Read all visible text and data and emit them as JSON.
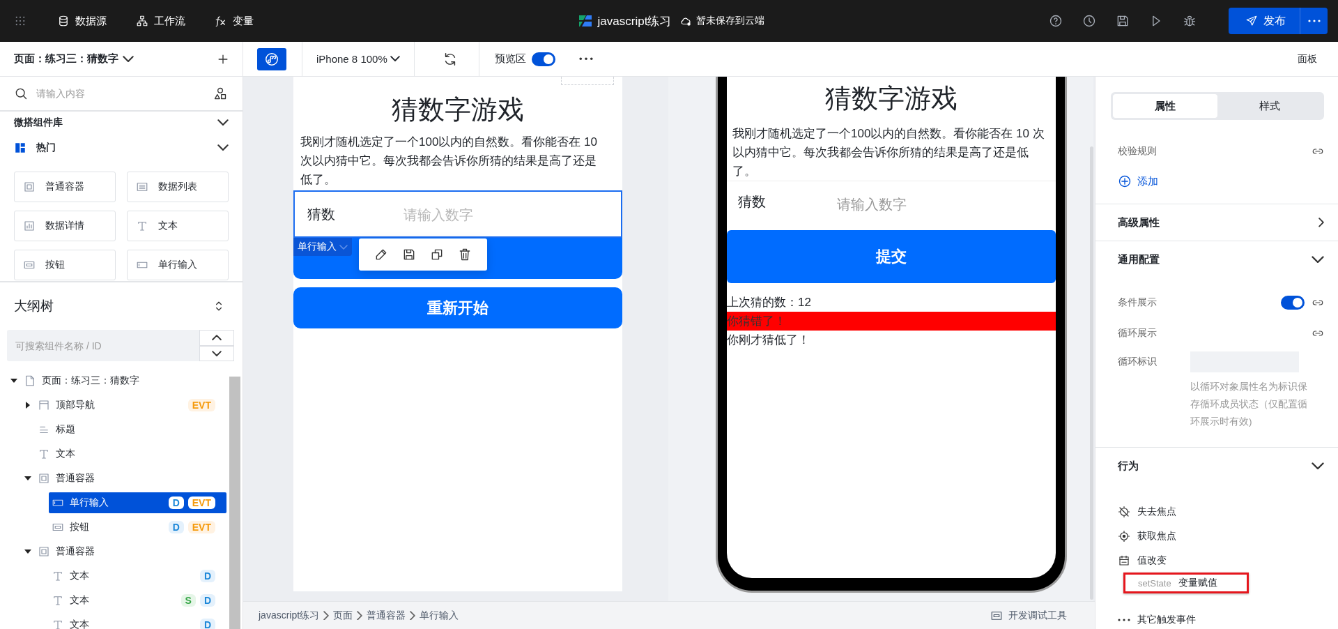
{
  "top_bar": {
    "nav": [
      {
        "label": "数据源",
        "kind": "database"
      },
      {
        "label": "工作流",
        "kind": "workflow"
      },
      {
        "label": "变量",
        "kind": "fx"
      }
    ],
    "app_title": "javascript练习",
    "save_status": "暂未保存到云端",
    "publish_button": "发布"
  },
  "left_panel": {
    "page_selector": "页面：练习三：猜数字",
    "search": {
      "placeholder": "请输入内容"
    },
    "library_title": "微搭组件库",
    "category": "热门",
    "components": [
      {
        "label": "普通容器",
        "kind": "container"
      },
      {
        "label": "数据列表",
        "kind": "list"
      },
      {
        "label": "数据详情",
        "kind": "detail"
      },
      {
        "label": "文本",
        "kind": "text"
      },
      {
        "label": "按钮",
        "kind": "button"
      },
      {
        "label": "单行输入",
        "kind": "input"
      }
    ],
    "outline": {
      "title": "大纲树",
      "search": {
        "placeholder": "可搜索组件名称 / ID"
      },
      "tree": [
        {
          "label": "页面：练习三：猜数字",
          "kind": "page",
          "expanded": true,
          "selected": false,
          "children": [
            {
              "label": "顶部导航",
              "kind": "nav",
              "expanded": false,
              "selected": false,
              "badges": [
                {
                  "text": "EVT",
                  "kind": "evt"
                }
              ]
            },
            {
              "label": "标题",
              "kind": "title",
              "selected": false
            },
            {
              "label": "文本",
              "kind": "text",
              "selected": false
            },
            {
              "label": "普通容器",
              "kind": "container",
              "expanded": true,
              "selected": false,
              "children": [
                {
                  "label": "单行输入",
                  "kind": "input",
                  "selected": true,
                  "badges": [
                    {
                      "text": "D",
                      "kind": "d"
                    },
                    {
                      "text": "EVT",
                      "kind": "evt"
                    }
                  ]
                },
                {
                  "label": "按钮",
                  "kind": "button",
                  "selected": false,
                  "badges": [
                    {
                      "text": "D",
                      "kind": "d"
                    },
                    {
                      "text": "EVT",
                      "kind": "evt"
                    }
                  ]
                }
              ]
            },
            {
              "label": "普通容器",
              "kind": "container",
              "expanded": true,
              "selected": false,
              "children": [
                {
                  "label": "文本",
                  "kind": "text",
                  "selected": false,
                  "badges": [
                    {
                      "text": "D",
                      "kind": "d"
                    }
                  ]
                },
                {
                  "label": "文本",
                  "kind": "text",
                  "selected": false,
                  "badges": [
                    {
                      "text": "S",
                      "kind": "s"
                    },
                    {
                      "text": "D",
                      "kind": "d"
                    }
                  ]
                },
                {
                  "label": "文本",
                  "kind": "text",
                  "selected": false,
                  "badges": [
                    {
                      "text": "D",
                      "kind": "d"
                    }
                  ]
                }
              ]
            }
          ]
        }
      ]
    }
  },
  "toolbar": {
    "device": "iPhone 8 100%",
    "preview_label": "预览区",
    "preview_on": true,
    "panel_label": "面板"
  },
  "editor_canvas": {
    "title": "猜数字游戏",
    "intro": "我刚才随机选定了一个100以内的自然数。看你能否在 10 次以内猜中它。每次我都会告诉你所猜的结果是高了还是低了。",
    "input": {
      "label": "猜数",
      "placeholder": "请输入数字"
    },
    "selection_tag": "单行输入",
    "restart_button": "重新开始"
  },
  "preview": {
    "title": "猜数字游戏",
    "intro": "我刚才随机选定了一个100以内的自然数。看你能否在 10 次以内猜中它。每次我都会告诉你所猜的结果是高了还是低了。",
    "input": {
      "label": "猜数",
      "placeholder": "请输入数字"
    },
    "submit_button": "提交",
    "last_guess": "上次猜的数：12",
    "result": "你猜错了！",
    "hint": "你刚才猜低了！"
  },
  "breadcrumb": [
    "javascript练习",
    "页面",
    "普通容器",
    "单行输入"
  ],
  "debug_tool": "开发调试工具",
  "right_panel": {
    "tabs": [
      {
        "label": "属性",
        "selected": true
      },
      {
        "label": "样式",
        "selected": false
      }
    ],
    "validation": {
      "label": "校验规则",
      "add": "添加"
    },
    "sections": [
      {
        "title": "高级属性",
        "expanded": false
      },
      {
        "title": "通用配置",
        "expanded": true,
        "rows": [
          {
            "label": "条件展示",
            "kind": "toggle",
            "on": true
          },
          {
            "label": "循环展示",
            "kind": "bind"
          },
          {
            "label": "循环标识",
            "kind": "input",
            "help": "以循环对象属性名为标识保存循环成员状态（仅配置循环展示时有效)"
          }
        ]
      },
      {
        "title": "行为",
        "expanded": true,
        "events": [
          {
            "label": "失去焦点",
            "kind": "blur"
          },
          {
            "label": "获取焦点",
            "kind": "focus"
          },
          {
            "label": "值改变",
            "kind": "change",
            "actions": [
              {
                "type": "setState",
                "label": "变量赋值",
                "highlighted": true
              }
            ]
          },
          {
            "label": "其它触发事件",
            "kind": "more"
          }
        ]
      }
    ]
  }
}
